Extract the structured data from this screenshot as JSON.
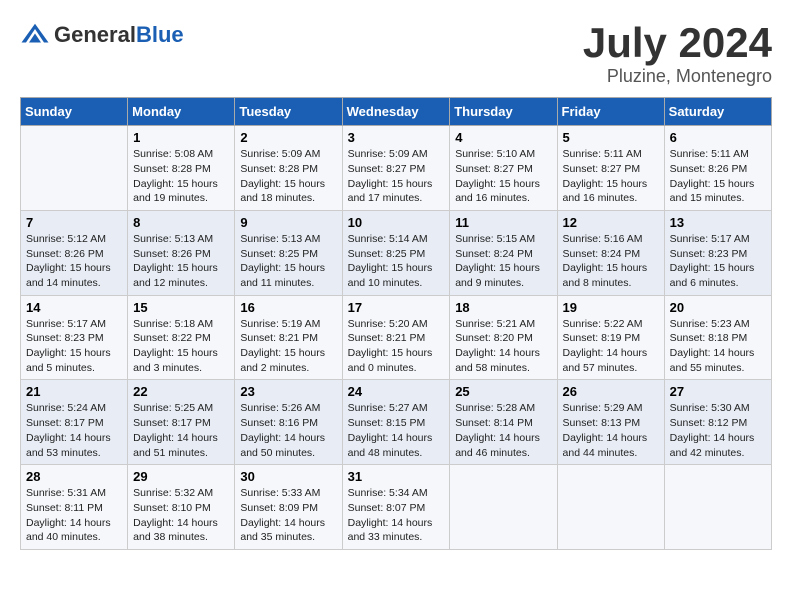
{
  "header": {
    "logo_general": "General",
    "logo_blue": "Blue",
    "month_title": "July 2024",
    "location": "Pluzine, Montenegro"
  },
  "weekdays": [
    "Sunday",
    "Monday",
    "Tuesday",
    "Wednesday",
    "Thursday",
    "Friday",
    "Saturday"
  ],
  "weeks": [
    [
      {
        "day": "",
        "sunrise": "",
        "sunset": "",
        "daylight": ""
      },
      {
        "day": "1",
        "sunrise": "Sunrise: 5:08 AM",
        "sunset": "Sunset: 8:28 PM",
        "daylight": "Daylight: 15 hours and 19 minutes."
      },
      {
        "day": "2",
        "sunrise": "Sunrise: 5:09 AM",
        "sunset": "Sunset: 8:28 PM",
        "daylight": "Daylight: 15 hours and 18 minutes."
      },
      {
        "day": "3",
        "sunrise": "Sunrise: 5:09 AM",
        "sunset": "Sunset: 8:27 PM",
        "daylight": "Daylight: 15 hours and 17 minutes."
      },
      {
        "day": "4",
        "sunrise": "Sunrise: 5:10 AM",
        "sunset": "Sunset: 8:27 PM",
        "daylight": "Daylight: 15 hours and 16 minutes."
      },
      {
        "day": "5",
        "sunrise": "Sunrise: 5:11 AM",
        "sunset": "Sunset: 8:27 PM",
        "daylight": "Daylight: 15 hours and 16 minutes."
      },
      {
        "day": "6",
        "sunrise": "Sunrise: 5:11 AM",
        "sunset": "Sunset: 8:26 PM",
        "daylight": "Daylight: 15 hours and 15 minutes."
      }
    ],
    [
      {
        "day": "7",
        "sunrise": "Sunrise: 5:12 AM",
        "sunset": "Sunset: 8:26 PM",
        "daylight": "Daylight: 15 hours and 14 minutes."
      },
      {
        "day": "8",
        "sunrise": "Sunrise: 5:13 AM",
        "sunset": "Sunset: 8:26 PM",
        "daylight": "Daylight: 15 hours and 12 minutes."
      },
      {
        "day": "9",
        "sunrise": "Sunrise: 5:13 AM",
        "sunset": "Sunset: 8:25 PM",
        "daylight": "Daylight: 15 hours and 11 minutes."
      },
      {
        "day": "10",
        "sunrise": "Sunrise: 5:14 AM",
        "sunset": "Sunset: 8:25 PM",
        "daylight": "Daylight: 15 hours and 10 minutes."
      },
      {
        "day": "11",
        "sunrise": "Sunrise: 5:15 AM",
        "sunset": "Sunset: 8:24 PM",
        "daylight": "Daylight: 15 hours and 9 minutes."
      },
      {
        "day": "12",
        "sunrise": "Sunrise: 5:16 AM",
        "sunset": "Sunset: 8:24 PM",
        "daylight": "Daylight: 15 hours and 8 minutes."
      },
      {
        "day": "13",
        "sunrise": "Sunrise: 5:17 AM",
        "sunset": "Sunset: 8:23 PM",
        "daylight": "Daylight: 15 hours and 6 minutes."
      }
    ],
    [
      {
        "day": "14",
        "sunrise": "Sunrise: 5:17 AM",
        "sunset": "Sunset: 8:23 PM",
        "daylight": "Daylight: 15 hours and 5 minutes."
      },
      {
        "day": "15",
        "sunrise": "Sunrise: 5:18 AM",
        "sunset": "Sunset: 8:22 PM",
        "daylight": "Daylight: 15 hours and 3 minutes."
      },
      {
        "day": "16",
        "sunrise": "Sunrise: 5:19 AM",
        "sunset": "Sunset: 8:21 PM",
        "daylight": "Daylight: 15 hours and 2 minutes."
      },
      {
        "day": "17",
        "sunrise": "Sunrise: 5:20 AM",
        "sunset": "Sunset: 8:21 PM",
        "daylight": "Daylight: 15 hours and 0 minutes."
      },
      {
        "day": "18",
        "sunrise": "Sunrise: 5:21 AM",
        "sunset": "Sunset: 8:20 PM",
        "daylight": "Daylight: 14 hours and 58 minutes."
      },
      {
        "day": "19",
        "sunrise": "Sunrise: 5:22 AM",
        "sunset": "Sunset: 8:19 PM",
        "daylight": "Daylight: 14 hours and 57 minutes."
      },
      {
        "day": "20",
        "sunrise": "Sunrise: 5:23 AM",
        "sunset": "Sunset: 8:18 PM",
        "daylight": "Daylight: 14 hours and 55 minutes."
      }
    ],
    [
      {
        "day": "21",
        "sunrise": "Sunrise: 5:24 AM",
        "sunset": "Sunset: 8:17 PM",
        "daylight": "Daylight: 14 hours and 53 minutes."
      },
      {
        "day": "22",
        "sunrise": "Sunrise: 5:25 AM",
        "sunset": "Sunset: 8:17 PM",
        "daylight": "Daylight: 14 hours and 51 minutes."
      },
      {
        "day": "23",
        "sunrise": "Sunrise: 5:26 AM",
        "sunset": "Sunset: 8:16 PM",
        "daylight": "Daylight: 14 hours and 50 minutes."
      },
      {
        "day": "24",
        "sunrise": "Sunrise: 5:27 AM",
        "sunset": "Sunset: 8:15 PM",
        "daylight": "Daylight: 14 hours and 48 minutes."
      },
      {
        "day": "25",
        "sunrise": "Sunrise: 5:28 AM",
        "sunset": "Sunset: 8:14 PM",
        "daylight": "Daylight: 14 hours and 46 minutes."
      },
      {
        "day": "26",
        "sunrise": "Sunrise: 5:29 AM",
        "sunset": "Sunset: 8:13 PM",
        "daylight": "Daylight: 14 hours and 44 minutes."
      },
      {
        "day": "27",
        "sunrise": "Sunrise: 5:30 AM",
        "sunset": "Sunset: 8:12 PM",
        "daylight": "Daylight: 14 hours and 42 minutes."
      }
    ],
    [
      {
        "day": "28",
        "sunrise": "Sunrise: 5:31 AM",
        "sunset": "Sunset: 8:11 PM",
        "daylight": "Daylight: 14 hours and 40 minutes."
      },
      {
        "day": "29",
        "sunrise": "Sunrise: 5:32 AM",
        "sunset": "Sunset: 8:10 PM",
        "daylight": "Daylight: 14 hours and 38 minutes."
      },
      {
        "day": "30",
        "sunrise": "Sunrise: 5:33 AM",
        "sunset": "Sunset: 8:09 PM",
        "daylight": "Daylight: 14 hours and 35 minutes."
      },
      {
        "day": "31",
        "sunrise": "Sunrise: 5:34 AM",
        "sunset": "Sunset: 8:07 PM",
        "daylight": "Daylight: 14 hours and 33 minutes."
      },
      {
        "day": "",
        "sunrise": "",
        "sunset": "",
        "daylight": ""
      },
      {
        "day": "",
        "sunrise": "",
        "sunset": "",
        "daylight": ""
      },
      {
        "day": "",
        "sunrise": "",
        "sunset": "",
        "daylight": ""
      }
    ]
  ]
}
